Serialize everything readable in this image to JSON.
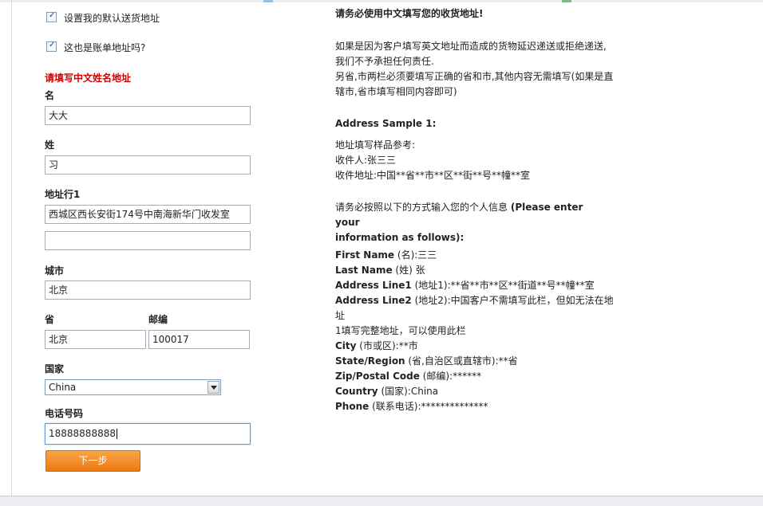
{
  "checkboxes": [
    {
      "label": "设置我的默认送货地址",
      "checked": true
    },
    {
      "label": "这也是账单地址吗?",
      "checked": true
    }
  ],
  "form": {
    "section_title": "请填写中文姓名地址",
    "first_name": {
      "label": "名",
      "value": "大大"
    },
    "last_name": {
      "label": "姓",
      "value": "习"
    },
    "address": {
      "label": "地址行1",
      "line1": "西城区西长安街174号中南海新华门收发室",
      "line2": ""
    },
    "city": {
      "label": "城市",
      "value": "北京"
    },
    "province": {
      "label": "省",
      "value": "北京"
    },
    "postcode": {
      "label": "邮编",
      "value": "100017"
    },
    "country": {
      "label": "国家",
      "value": "China"
    },
    "phone": {
      "label": "电话号码",
      "value": "18888888888"
    },
    "next_button": "下一步"
  },
  "notice": {
    "heading": "请务必使用中文填写您的收货地址!",
    "para1_line1": "如果是因为客户填写英文地址而造成的货物延迟递送或拒绝递送,",
    "para1_line2": "我们不予承担任何责任.",
    "para1_line3": "另省,市两栏必须要填写正确的省和市,其他内容无需填写(如果是直",
    "para1_line4": "辖市,省市填写相同内容即可)",
    "sample_heading": "Address Sample 1:",
    "sample_line1": "地址填写样品参考:",
    "sample_line2": "收件人:张三三",
    "sample_line3": "收件地址:中国**省**市**区**街**号**幢**室",
    "instruction_cn": "请务必按照以下的方式输入您的个人信息 ",
    "instruction_en_line1": "(Please enter your",
    "instruction_en_line2": "information as follows):",
    "fields": [
      {
        "key": "First Name",
        "text": " (名):三三"
      },
      {
        "key": "Last Name",
        "text": " (姓) 张"
      },
      {
        "key": "Address Line1",
        "text": " (地址1):**省**市**区**街道**号**幢**室"
      },
      {
        "key": "Address Line2",
        "text": " (地址2):中国客户不需填写此栏，但如无法在地址"
      },
      {
        "key": "",
        "text": "1填写完整地址，可以使用此栏"
      },
      {
        "key": "City",
        "text": " (市或区):**市"
      },
      {
        "key": "State/Region",
        "text": " (省,自治区或直辖市):**省"
      },
      {
        "key": "Zip/Postal Code",
        "text": " (邮编):******"
      },
      {
        "key": "Country",
        "text": " (国家):China"
      },
      {
        "key": "Phone",
        "text": " (联系电话):**************"
      }
    ]
  }
}
